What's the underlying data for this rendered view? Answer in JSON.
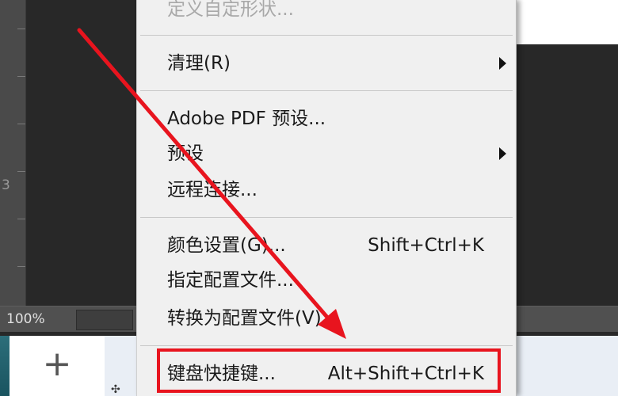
{
  "ruler": {
    "number": "3"
  },
  "statusbar": {
    "zoom": "100%"
  },
  "new_button": {
    "label": "+"
  },
  "menu": {
    "items": [
      {
        "label": "定义自定形状...",
        "disabled": true
      },
      {
        "label": "清理(R)",
        "submenu": true
      },
      {
        "label": "Adobe PDF 预设..."
      },
      {
        "label": "预设",
        "submenu": true
      },
      {
        "label": "远程连接..."
      },
      {
        "label": "颜色设置(G)...",
        "shortcut": "Shift+Ctrl+K"
      },
      {
        "label": "指定配置文件..."
      },
      {
        "label": "转换为配置文件(V)..."
      },
      {
        "label": "键盘快捷键...",
        "shortcut": "Alt+Shift+Ctrl+K"
      }
    ]
  },
  "annotation": {
    "color": "#e8141e"
  }
}
